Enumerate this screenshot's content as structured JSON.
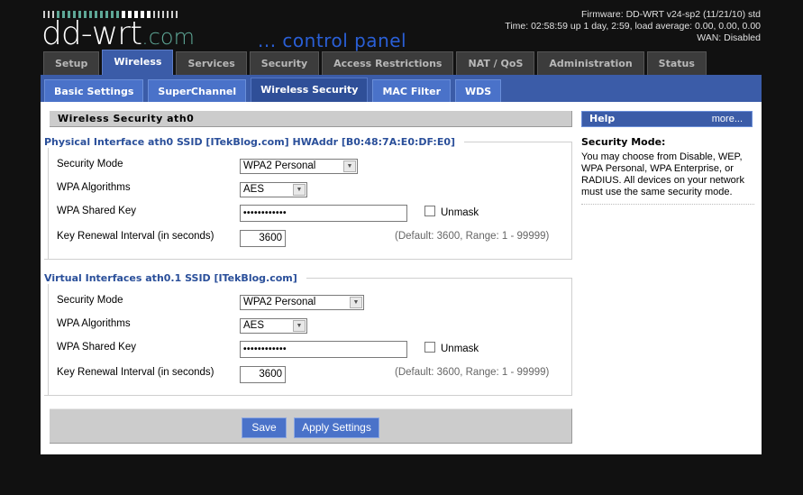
{
  "header": {
    "logo_text": "dd-wrt",
    "logo_domain": ".com",
    "subtitle": "... control panel",
    "firmware": "Firmware: DD-WRT v24-sp2 (11/21/10) std",
    "time": "Time: 02:58:59 up 1 day, 2:59, load average: 0.00, 0.00, 0.00",
    "wan": "WAN: Disabled"
  },
  "main_tabs": [
    {
      "label": "Setup",
      "active": false
    },
    {
      "label": "Wireless",
      "active": true
    },
    {
      "label": "Services",
      "active": false
    },
    {
      "label": "Security",
      "active": false
    },
    {
      "label": "Access Restrictions",
      "active": false
    },
    {
      "label": "NAT / QoS",
      "active": false
    },
    {
      "label": "Administration",
      "active": false
    },
    {
      "label": "Status",
      "active": false
    }
  ],
  "sub_tabs": [
    {
      "label": "Basic Settings",
      "active": false
    },
    {
      "label": "SuperChannel",
      "active": false
    },
    {
      "label": "Wireless Security",
      "active": true
    },
    {
      "label": "MAC Filter",
      "active": false
    },
    {
      "label": "WDS",
      "active": false
    }
  ],
  "section_title": "Wireless Security ath0",
  "interfaces": [
    {
      "legend": "Physical Interface ath0 SSID [ITekBlog.com] HWAddr [B0:48:7A:E0:DF:E0]",
      "security_mode_label": "Security Mode",
      "security_mode_value": "WPA2 Personal",
      "wpa_algorithms_label": "WPA Algorithms",
      "wpa_algorithms_value": "AES",
      "shared_key_label": "WPA Shared Key",
      "shared_key_value": "••••••••••••",
      "unmask_label": "Unmask",
      "renewal_label": "Key Renewal Interval (in seconds)",
      "renewal_value": "3600",
      "renewal_hint": "(Default: 3600, Range: 1 - 99999)"
    },
    {
      "legend": "Virtual Interfaces ath0.1 SSID [ITekBlog.com]",
      "security_mode_label": "Security Mode",
      "security_mode_value": "WPA2 Personal",
      "wpa_algorithms_label": "WPA Algorithms",
      "wpa_algorithms_value": "AES",
      "shared_key_label": "WPA Shared Key",
      "shared_key_value": "••••••••••••",
      "unmask_label": "Unmask",
      "renewal_label": "Key Renewal Interval (in seconds)",
      "renewal_value": "3600",
      "renewal_hint": "(Default: 3600, Range: 1 - 99999)"
    }
  ],
  "buttons": {
    "save": "Save",
    "apply": "Apply Settings"
  },
  "help": {
    "title": "Help",
    "more": "more...",
    "subtitle": "Security Mode:",
    "text": "You may choose from Disable, WEP, WPA Personal, WPA Enterprise, or RADIUS. All devices on your network must use the same security mode."
  },
  "icons": {
    "dropdown": "chevron-down-icon"
  }
}
